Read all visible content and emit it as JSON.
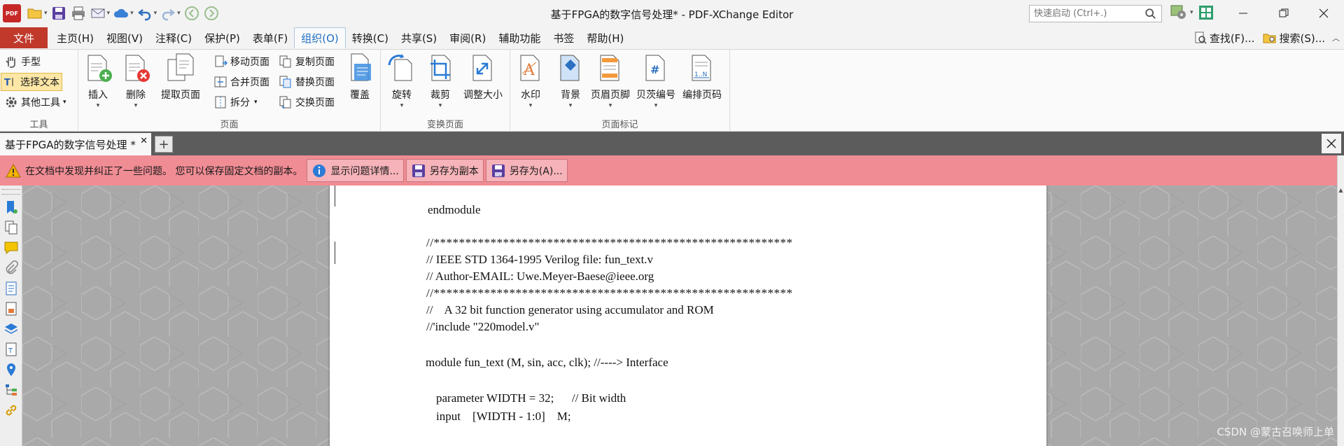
{
  "window": {
    "title": "基于FPGA的数字信号处理* - PDF-XChange Editor",
    "app_logo_text": "PDF",
    "quick_search_placeholder": "快速启动 (Ctrl+.)"
  },
  "menu": {
    "file": "文件",
    "items": [
      "主页(H)",
      "视图(V)",
      "注释(C)",
      "保护(P)",
      "表单(F)",
      "组织(O)",
      "转换(C)",
      "共享(S)",
      "审阅(R)",
      "辅助功能",
      "书签",
      "帮助(H)"
    ],
    "active_index": 5,
    "find": "查找(F)...",
    "search": "搜索(S)..."
  },
  "ribbon": {
    "tools": {
      "label": "工具",
      "hand": "手型",
      "select_text": "选择文本",
      "other_tools": "其他工具"
    },
    "pages": {
      "label": "页面",
      "insert": "插入",
      "delete": "删除",
      "extract": "提取页面",
      "move": "移动页面",
      "merge": "合并页面",
      "split": "拆分",
      "copy": "复制页面",
      "replace": "替换页面",
      "swap": "交换页面",
      "overlay": "覆盖"
    },
    "transform": {
      "label": "变换页面",
      "rotate": "旋转",
      "crop": "裁剪",
      "resize": "调整大小"
    },
    "marks": {
      "label": "页面标记",
      "watermark": "水印",
      "background": "背景",
      "header_footer": "页眉页脚",
      "bates": "贝茨编号",
      "page_number": "编排页码"
    }
  },
  "doc_tab": {
    "title": "基于FPGA的数字信号处理 *",
    "new_tab": "+"
  },
  "notification": {
    "message": "在文档中发现并纠正了一些问题。 您可以保存固定文档的副本。",
    "show_details": "显示问题详情...",
    "save_copy": "另存为副本",
    "save_as": "另存为(A)..."
  },
  "document": {
    "lines": [
      "endmodule",
      "//*********************************************************",
      "// IEEE STD 1364-1995 Verilog file: fun_text.v",
      "// Author-EMAIL: Uwe.Meyer-Baese@ieee.org",
      "//*********************************************************",
      "//    A 32 bit function generator using accumulator and ROM",
      "//'include \"220model.v\"",
      "module fun_text (M, sin, acc, clk); //----> Interface",
      "parameter WIDTH = 32;      // Bit width",
      "input    [WIDTH - 1:0]    M;"
    ]
  },
  "watermark": "CSDN @蒙古召唤师上单"
}
